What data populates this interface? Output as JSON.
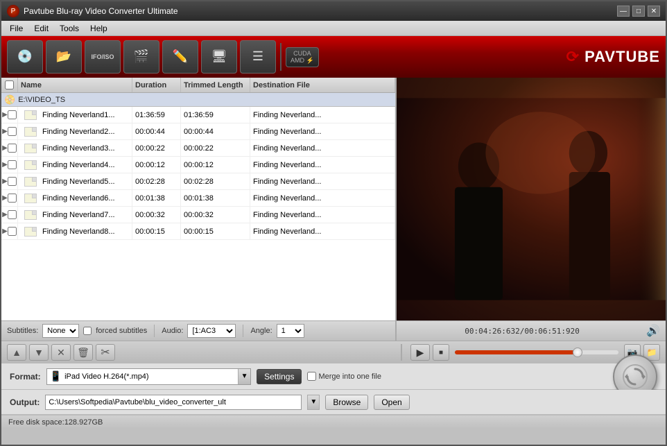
{
  "titleBar": {
    "icon": "●",
    "title": "Pavtube Blu-ray Video Converter Ultimate",
    "minimize": "—",
    "maximize": "□",
    "close": "✕"
  },
  "menuBar": {
    "items": [
      "File",
      "Edit",
      "Tools",
      "Help"
    ]
  },
  "toolbar": {
    "buttons": [
      {
        "name": "disc-button",
        "icon": "💿",
        "label": ""
      },
      {
        "name": "folder-button",
        "icon": "📂",
        "label": ""
      },
      {
        "name": "ifo-button",
        "icon": "IFO/ISO",
        "label": ""
      },
      {
        "name": "add-button",
        "icon": "➕",
        "label": ""
      },
      {
        "name": "edit-button",
        "icon": "✏",
        "label": ""
      },
      {
        "name": "preview-button",
        "icon": "🖥",
        "label": ""
      },
      {
        "name": "list-button",
        "icon": "☰",
        "label": ""
      }
    ],
    "cuda_label": "CUDA\nAMD"
  },
  "fileList": {
    "columns": {
      "name": "Name",
      "duration": "Duration",
      "trimmedLength": "Trimmed Length",
      "destinationFile": "Destination File"
    },
    "groupHeader": "E:\\VIDEO_TS",
    "rows": [
      {
        "name": "Finding Neverland1...",
        "duration": "01:36:59",
        "trimmed": "01:36:59",
        "dest": "Finding Neverland..."
      },
      {
        "name": "Finding Neverland2...",
        "duration": "00:00:44",
        "trimmed": "00:00:44",
        "dest": "Finding Neverland..."
      },
      {
        "name": "Finding Neverland3...",
        "duration": "00:00:22",
        "trimmed": "00:00:22",
        "dest": "Finding Neverland..."
      },
      {
        "name": "Finding Neverland4...",
        "duration": "00:00:12",
        "trimmed": "00:00:12",
        "dest": "Finding Neverland..."
      },
      {
        "name": "Finding Neverland5...",
        "duration": "00:02:28",
        "trimmed": "00:02:28",
        "dest": "Finding Neverland..."
      },
      {
        "name": "Finding Neverland6...",
        "duration": "00:01:38",
        "trimmed": "00:01:38",
        "dest": "Finding Neverland..."
      },
      {
        "name": "Finding Neverland7...",
        "duration": "00:00:32",
        "trimmed": "00:00:32",
        "dest": "Finding Neverland..."
      },
      {
        "name": "Finding Neverland8...",
        "duration": "00:00:15",
        "trimmed": "00:00:15",
        "dest": "Finding Neverland..."
      }
    ]
  },
  "controls": {
    "subtitlesLabel": "Subtitles:",
    "subtitlesValue": "None",
    "forcedLabel": "forced subtitles",
    "audioLabel": "Audio:",
    "audioValue": "[1:AC3",
    "angleLabel": "Angle:",
    "angleValue": "1",
    "timeDisplay": "00:04:26:632/00:06:51:920"
  },
  "playback": {
    "upArrow": "▲",
    "downArrow": "▼",
    "deleteX": "✕",
    "trash": "🗑",
    "scissors": "✂"
  },
  "format": {
    "label": "Format:",
    "value": "iPad Video H.264(*.mp4)",
    "settingsLabel": "Settings",
    "mergeLabel": "Merge into one file"
  },
  "output": {
    "label": "Output:",
    "value": "C:\\Users\\Softpedia\\Pavtube\\blu_video_converter_ult",
    "browseLabel": "Browse",
    "openLabel": "Open"
  },
  "statusBar": {
    "text": "Free disk space:128.927GB"
  }
}
